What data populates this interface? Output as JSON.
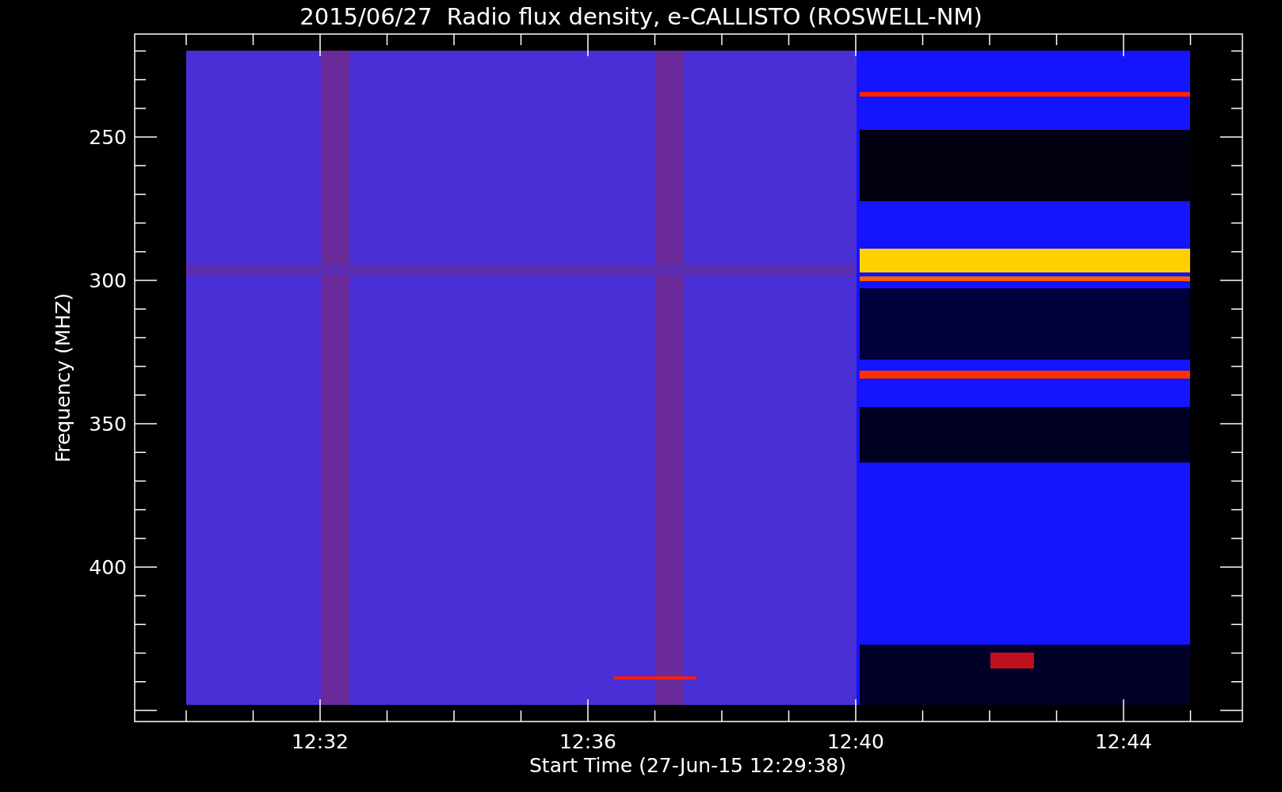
{
  "title": "2015/06/27  Radio flux density, e-CALLISTO (ROSWELL-NM)",
  "y_axis": {
    "label": "Frequency (MHZ)",
    "ticks": [
      "250",
      "300",
      "350",
      "400"
    ]
  },
  "x_axis": {
    "label": "Start Time (27-Jun-15 12:29:38)",
    "ticks": [
      "12:32",
      "12:36",
      "12:40",
      "12:44"
    ]
  }
}
